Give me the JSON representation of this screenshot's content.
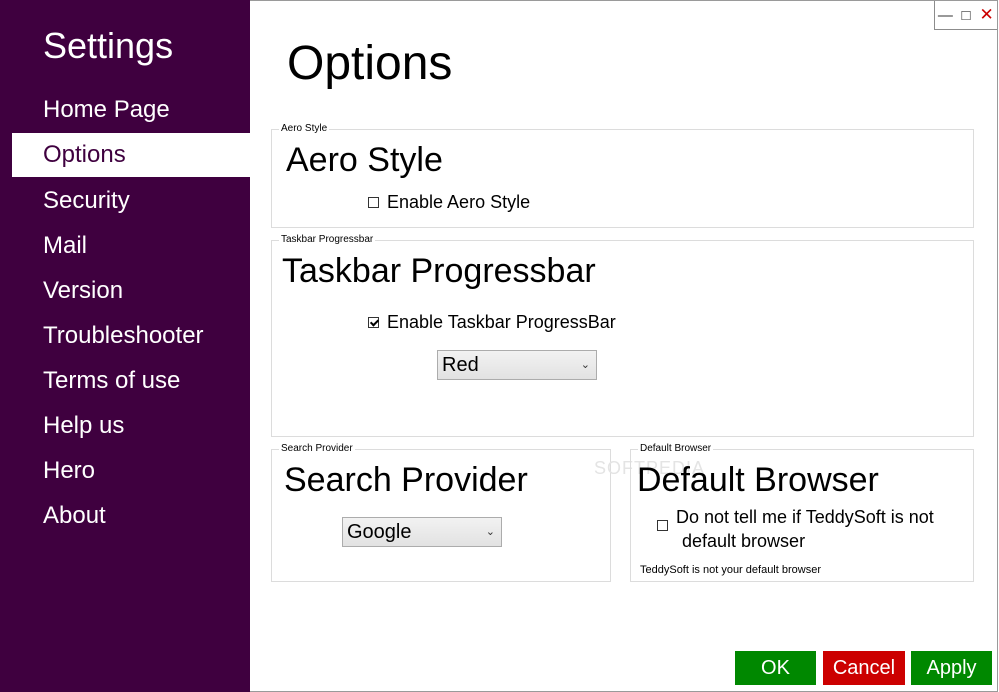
{
  "sidebar": {
    "title": "Settings",
    "items": [
      {
        "label": "Home Page"
      },
      {
        "label": "Options"
      },
      {
        "label": "Security"
      },
      {
        "label": "Mail"
      },
      {
        "label": "Version"
      },
      {
        "label": "Troubleshooter"
      },
      {
        "label": "Terms of use"
      },
      {
        "label": "Help us"
      },
      {
        "label": "Hero"
      },
      {
        "label": "About"
      }
    ],
    "selected": "Options",
    "bg_color": "#3f003f"
  },
  "window": {
    "minimize_icon": "minimize-icon",
    "maximize_icon": "maximize-icon",
    "close_icon": "close-icon"
  },
  "page": {
    "title": "Options"
  },
  "aero": {
    "caption": "Aero Style",
    "heading": "Aero Style",
    "checkbox_label": "Enable Aero Style",
    "checked": false
  },
  "taskbar": {
    "caption": "Taskbar Progressbar",
    "heading": "Taskbar Progressbar",
    "checkbox_label": "Enable Taskbar ProgressBar",
    "checked": true,
    "color_value": "Red"
  },
  "search": {
    "caption": "Search Provider",
    "heading": "Search Provider",
    "provider_value": "Google"
  },
  "browser": {
    "caption": "Default Browser",
    "heading": "Default Browser",
    "checkbox_line1": "Do not tell me if TeddySoft is not",
    "checkbox_line2": "default browser",
    "checked": false,
    "status": "TeddySoft is not your default browser"
  },
  "watermark": "SOFTPEDIA",
  "buttons": {
    "ok": "OK",
    "cancel": "Cancel",
    "apply": "Apply",
    "ok_color": "#008800",
    "cancel_color": "#cc0000",
    "apply_color": "#008800"
  }
}
